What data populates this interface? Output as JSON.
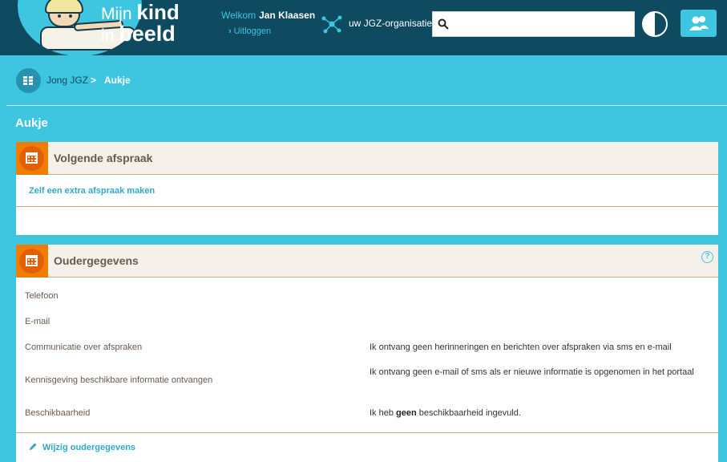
{
  "header": {
    "logo": {
      "word1": "Mijn",
      "word2": "kind",
      "word3": "in",
      "word4": "beeld"
    },
    "welcome_label": "Welkom",
    "user_name": "Jan Klaasen",
    "logout_label": "Uitloggen",
    "org_label": "uw JGZ-organisaties",
    "search_placeholder": "",
    "search_value": ""
  },
  "breadcrumb": {
    "items": [
      "Jong JGZ",
      "Aukje"
    ],
    "separator": ">"
  },
  "page": {
    "title": "Aukje"
  },
  "appointment_panel": {
    "title": "Volgende afspraak",
    "link": "Zelf een extra afspraak maken"
  },
  "parent_panel": {
    "title": "Oudergegevens",
    "help": "?",
    "rows": [
      {
        "label": "Telefoon",
        "value": ""
      },
      {
        "label": "E-mail",
        "value": ""
      },
      {
        "label": "Communicatie over afspraken",
        "value": "Ik ontvang geen herinneringen en berichten over afspraken via sms en e-mail"
      },
      {
        "label": "Kennisgeving beschikbare informatie ontvangen",
        "value": "Ik ontvang geen e-mail of sms als er nieuwe informatie is opgenomen in het portaal"
      },
      {
        "label": "Beschikbaarheid",
        "value_pre": "Ik heb ",
        "value_bold": "geen",
        "value_post": " beschikbaarheid ingevuld."
      }
    ],
    "edit_link": "Wijzig oudergegevens"
  },
  "colors": {
    "header_bg": "#0e4a60",
    "page_bg": "#3ec6e0",
    "accent_orange": "#f07d00",
    "panel_head_bg": "#f5f0ea",
    "link": "#2fa9c9"
  },
  "icons": [
    "search-icon",
    "contrast-icon",
    "users-icon",
    "network-icon",
    "grid-icon",
    "calendar-icon",
    "help-icon",
    "pencil-icon",
    "chevron-right-icon"
  ]
}
